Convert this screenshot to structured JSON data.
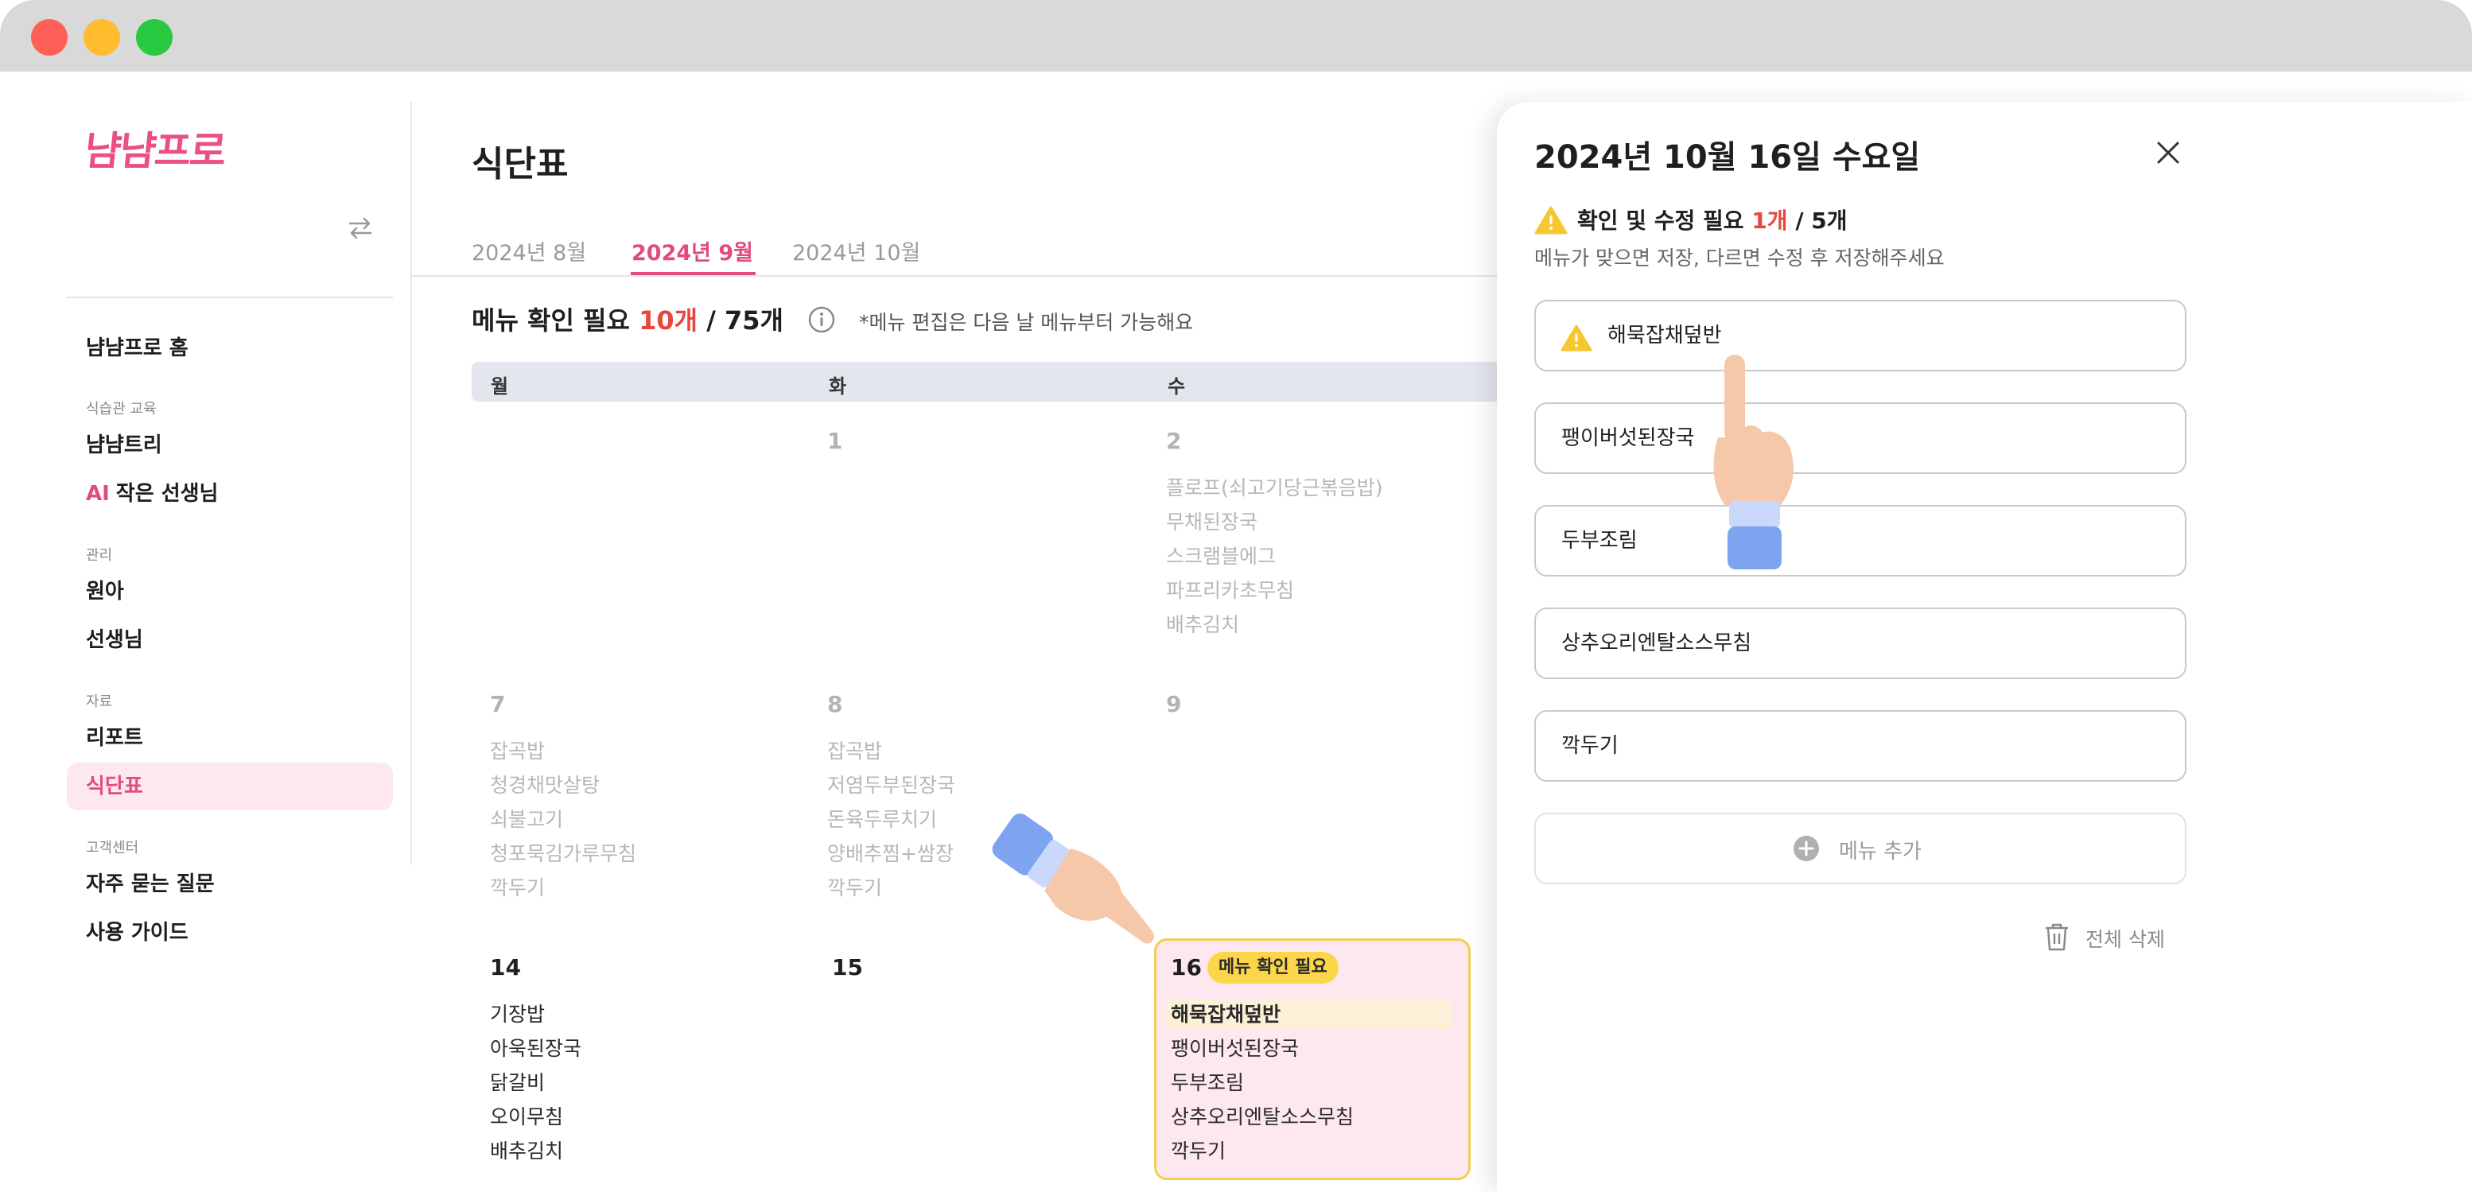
{
  "app": {
    "logo": "냠냠프로"
  },
  "sidebar": {
    "home": "냠냠프로 홈",
    "groups": {
      "education": "식습관 교육",
      "management": "관리",
      "resources": "자료",
      "support": "고객센터"
    },
    "items": {
      "tree": "냠냠트리",
      "ai_badge": "AI",
      "ai_teacher": "작은 선생님",
      "children": "원아",
      "teachers": "선생님",
      "report": "리포트",
      "meal_plan": "식단표",
      "faq": "자주 묻는 질문",
      "guide": "사용 가이드"
    }
  },
  "main": {
    "title": "식단표",
    "tabs": [
      "2024년 8월",
      "2024년 9월",
      "2024년 10월"
    ],
    "active_tab": 1,
    "summary": {
      "label": "메뉴 확인 필요",
      "count": "10개",
      "total": " / 75개"
    },
    "edit_note": "*메뉴 편집은 다음 날 메뉴부터 가능해요",
    "weekdays": [
      "월",
      "화",
      "수"
    ],
    "days": {
      "d1": {
        "num": "1",
        "menu": []
      },
      "d2": {
        "num": "2",
        "menu": [
          "플로프(쇠고기당근볶음밥)",
          "무채된장국",
          "스크램블에그",
          "파프리카초무침",
          "배추김치"
        ]
      },
      "d7": {
        "num": "7",
        "menu": [
          "잡곡밥",
          "청경채맛살탕",
          "쇠불고기",
          "청포묵김가루무침",
          "깍두기"
        ]
      },
      "d8": {
        "num": "8",
        "menu": [
          "잡곡밥",
          "저염두부된장국",
          "돈육두루치기",
          "양배추찜+쌈장",
          "깍두기"
        ]
      },
      "d9": {
        "num": "9",
        "menu": []
      },
      "d14": {
        "num": "14",
        "menu": [
          "기장밥",
          "아욱된장국",
          "닭갈비",
          "오이무침",
          "배추김치"
        ]
      },
      "d15": {
        "num": "15",
        "menu": []
      },
      "d16": {
        "num": "16",
        "badge": "메뉴 확인 필요",
        "menu": [
          "해묵잡채덮반",
          "팽이버섯된장국",
          "두부조림",
          "상추오리엔탈소스무침",
          "깍두기"
        ]
      }
    }
  },
  "panel": {
    "date": "2024년 10월 16일 수요일",
    "warn_label": "확인 및 수정 필요",
    "warn_count": "1개",
    "warn_total": " / 5개",
    "subtitle": "메뉴가 맞으면 저장, 다르면 수정 후 저장해주세요",
    "menus": [
      "해묵잡채덮반",
      "팽이버섯된장국",
      "두부조림",
      "상추오리엔탈소스무침",
      "깍두기"
    ],
    "add_label": "메뉴 추가",
    "delete_all_label": "전체 삭제"
  },
  "colors": {
    "accent": "#e14b7e",
    "warning": "#f2cf53",
    "alert_red": "#e8463e"
  }
}
